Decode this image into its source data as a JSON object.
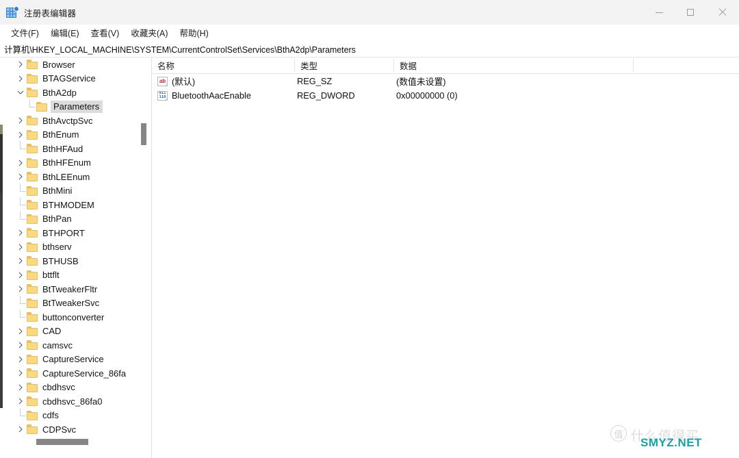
{
  "window": {
    "title": "注册表编辑器",
    "icon": "registry-editor-icon",
    "controls": {
      "minimize": "minimize-icon",
      "maximize": "maximize-icon",
      "close": "close-icon"
    }
  },
  "menubar": {
    "items": [
      {
        "label": "文件(F)"
      },
      {
        "label": "编辑(E)"
      },
      {
        "label": "查看(V)"
      },
      {
        "label": "收藏夹(A)"
      },
      {
        "label": "帮助(H)"
      }
    ]
  },
  "address": {
    "path": "计算机\\HKEY_LOCAL_MACHINE\\SYSTEM\\CurrentControlSet\\Services\\BthA2dp\\Parameters"
  },
  "tree": {
    "items": [
      {
        "label": "Browser",
        "depth": 1,
        "state": "collapsed",
        "selected": false
      },
      {
        "label": "BTAGService",
        "depth": 1,
        "state": "collapsed",
        "selected": false
      },
      {
        "label": "BthA2dp",
        "depth": 1,
        "state": "expanded",
        "selected": false
      },
      {
        "label": "Parameters",
        "depth": 2,
        "state": "leaf",
        "selected": true
      },
      {
        "label": "BthAvctpSvc",
        "depth": 1,
        "state": "collapsed",
        "selected": false
      },
      {
        "label": "BthEnum",
        "depth": 1,
        "state": "collapsed",
        "selected": false
      },
      {
        "label": "BthHFAud",
        "depth": 1,
        "state": "leaf",
        "selected": false
      },
      {
        "label": "BthHFEnum",
        "depth": 1,
        "state": "collapsed",
        "selected": false
      },
      {
        "label": "BthLEEnum",
        "depth": 1,
        "state": "collapsed",
        "selected": false
      },
      {
        "label": "BthMini",
        "depth": 1,
        "state": "leaf",
        "selected": false
      },
      {
        "label": "BTHMODEM",
        "depth": 1,
        "state": "leaf",
        "selected": false
      },
      {
        "label": "BthPan",
        "depth": 1,
        "state": "leaf",
        "selected": false
      },
      {
        "label": "BTHPORT",
        "depth": 1,
        "state": "collapsed",
        "selected": false
      },
      {
        "label": "bthserv",
        "depth": 1,
        "state": "collapsed",
        "selected": false
      },
      {
        "label": "BTHUSB",
        "depth": 1,
        "state": "collapsed",
        "selected": false
      },
      {
        "label": "bttflt",
        "depth": 1,
        "state": "collapsed",
        "selected": false
      },
      {
        "label": "BtTweakerFltr",
        "depth": 1,
        "state": "collapsed",
        "selected": false
      },
      {
        "label": "BtTweakerSvc",
        "depth": 1,
        "state": "leaf",
        "selected": false
      },
      {
        "label": "buttonconverter",
        "depth": 1,
        "state": "leaf",
        "selected": false
      },
      {
        "label": "CAD",
        "depth": 1,
        "state": "collapsed",
        "selected": false
      },
      {
        "label": "camsvc",
        "depth": 1,
        "state": "collapsed",
        "selected": false
      },
      {
        "label": "CaptureService",
        "depth": 1,
        "state": "collapsed",
        "selected": false
      },
      {
        "label": "CaptureService_86fa",
        "depth": 1,
        "state": "collapsed",
        "selected": false
      },
      {
        "label": "cbdhsvc",
        "depth": 1,
        "state": "collapsed",
        "selected": false
      },
      {
        "label": "cbdhsvc_86fa0",
        "depth": 1,
        "state": "collapsed",
        "selected": false
      },
      {
        "label": "cdfs",
        "depth": 1,
        "state": "leaf",
        "selected": false
      },
      {
        "label": "CDPSvc",
        "depth": 1,
        "state": "collapsed",
        "selected": false
      }
    ]
  },
  "values": {
    "columns": [
      {
        "label": "名称"
      },
      {
        "label": "类型"
      },
      {
        "label": "数据"
      }
    ],
    "rows": [
      {
        "name": "(默认)",
        "type": "REG_SZ",
        "data": "(数值未设置)",
        "icon": "string-value-icon",
        "icon_glyph": "ab"
      },
      {
        "name": "BluetoothAacEnable",
        "type": "REG_DWORD",
        "data": "0x00000000 (0)",
        "icon": "dword-value-icon",
        "icon_glyph_top": "011",
        "icon_glyph_bottom": "110"
      }
    ]
  },
  "watermark": {
    "logo": "值",
    "cn_text": "什么值得买",
    "site": "SMYZ.NET"
  },
  "colors": {
    "titlebar": "#f3f3f3",
    "selection": "#dcdcdc",
    "folder": "#fbd981",
    "scrollbar_thumb": "#868686",
    "watermark_accent": "#17a2a8"
  }
}
